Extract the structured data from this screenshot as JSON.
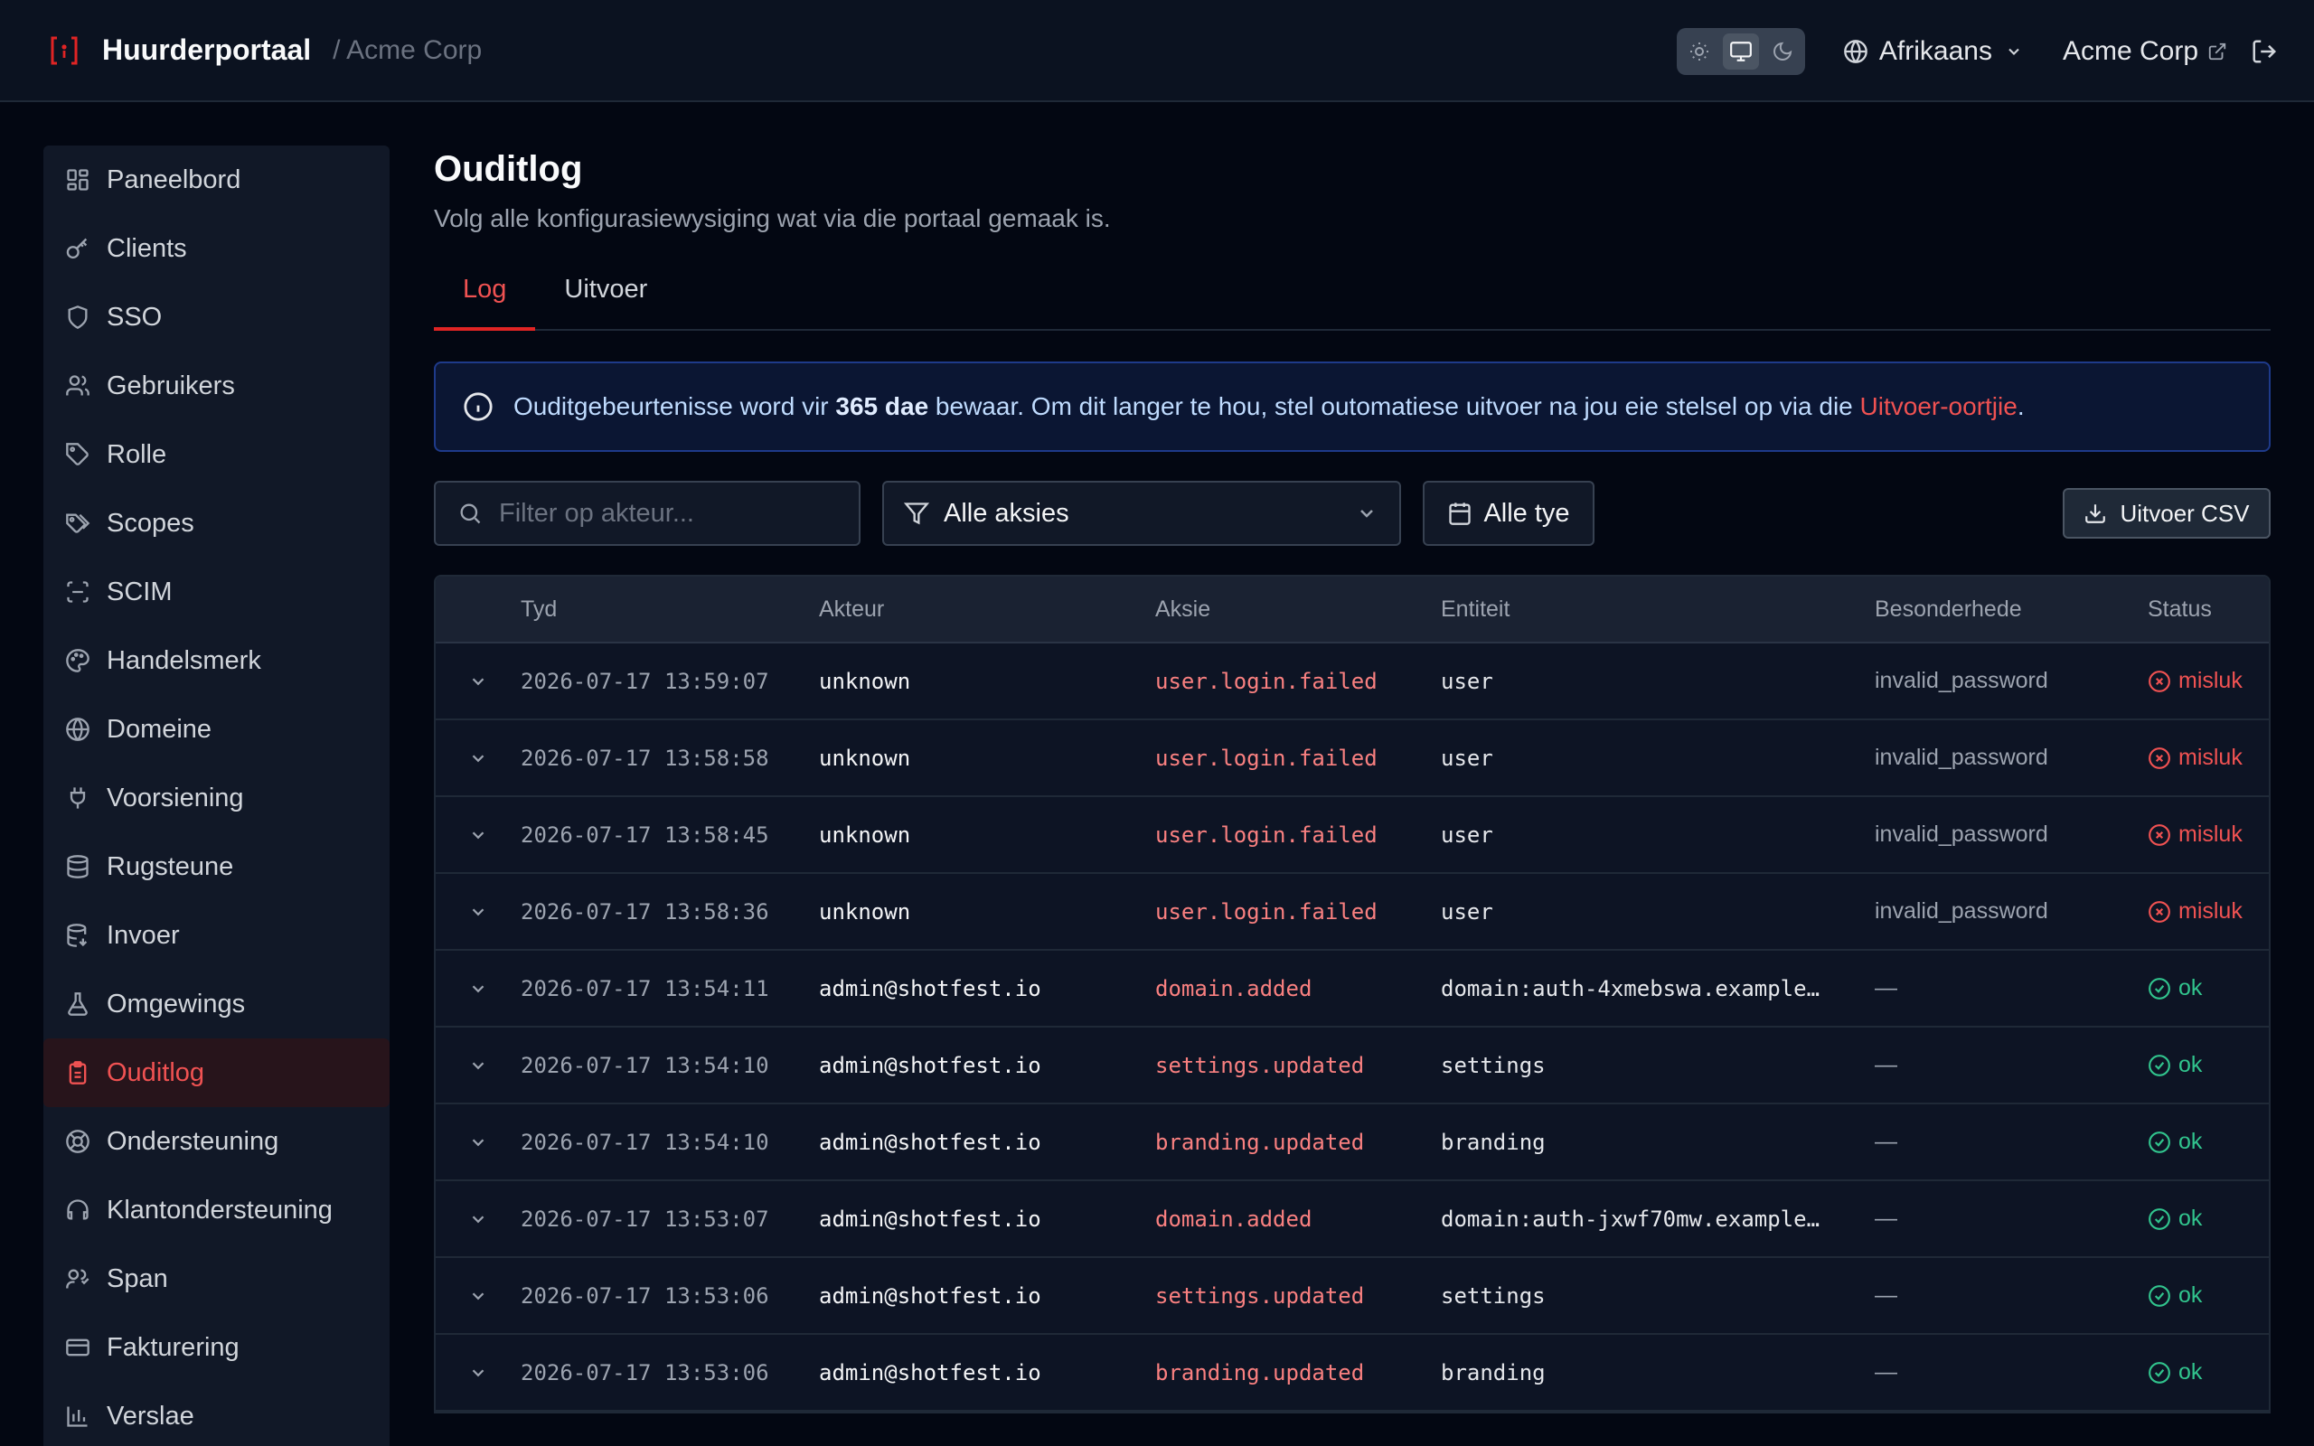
{
  "header": {
    "brand_title": "Huurderportaal",
    "brand_sub": "/ Acme Corp",
    "language": "Afrikaans",
    "org_link": "Acme Corp"
  },
  "sidebar": {
    "items": [
      {
        "label": "Paneelbord",
        "icon": "dashboard-icon"
      },
      {
        "label": "Clients",
        "icon": "key-icon"
      },
      {
        "label": "SSO",
        "icon": "shield-icon"
      },
      {
        "label": "Gebruikers",
        "icon": "users-icon"
      },
      {
        "label": "Rolle",
        "icon": "tag-icon"
      },
      {
        "label": "Scopes",
        "icon": "tags-icon"
      },
      {
        "label": "SCIM",
        "icon": "scan-icon"
      },
      {
        "label": "Handelsmerk",
        "icon": "palette-icon"
      },
      {
        "label": "Domeine",
        "icon": "globe-icon"
      },
      {
        "label": "Voorsiening",
        "icon": "plug-icon"
      },
      {
        "label": "Rugsteune",
        "icon": "database-icon"
      },
      {
        "label": "Invoer",
        "icon": "database-import-icon"
      },
      {
        "label": "Omgewings",
        "icon": "flask-icon"
      },
      {
        "label": "Ouditlog",
        "icon": "clipboard-icon"
      },
      {
        "label": "Ondersteuning",
        "icon": "lifebuoy-icon"
      },
      {
        "label": "Klantondersteuning",
        "icon": "headset-icon"
      },
      {
        "label": "Span",
        "icon": "user-group-icon"
      },
      {
        "label": "Fakturering",
        "icon": "credit-card-icon"
      },
      {
        "label": "Verslae",
        "icon": "bar-chart-icon"
      }
    ],
    "active": "Ouditlog"
  },
  "main": {
    "title": "Ouditlog",
    "subtitle": "Volg alle konfigurasiewysiging wat via die portaal gemaak is.",
    "tabs": [
      {
        "label": "Log"
      },
      {
        "label": "Uitvoer"
      }
    ],
    "banner": {
      "text_before": "Ouditgebeurtenisse word vir ",
      "bold": "365 dae",
      "text_after": " bewaar. Om dit langer te hou, stel outomatiese uitvoer na jou eie stelsel op via die ",
      "link": "Uitvoer-oortjie",
      "end": "."
    },
    "filters": {
      "search_placeholder": "Filter op akteur...",
      "action_select": "Alle aksies",
      "date_range": "Alle tye",
      "export_label": "Uitvoer CSV"
    },
    "table": {
      "headers": {
        "time": "Tyd",
        "actor": "Akteur",
        "action": "Aksie",
        "entity": "Entiteit",
        "details": "Besonderhede",
        "status": "Status"
      },
      "rows": [
        {
          "time": "2026-07-17 13:59:07",
          "actor": "unknown",
          "action": "user.login.failed",
          "entity": "user",
          "details": "invalid_password",
          "status": "misluk"
        },
        {
          "time": "2026-07-17 13:58:58",
          "actor": "unknown",
          "action": "user.login.failed",
          "entity": "user",
          "details": "invalid_password",
          "status": "misluk"
        },
        {
          "time": "2026-07-17 13:58:45",
          "actor": "unknown",
          "action": "user.login.failed",
          "entity": "user",
          "details": "invalid_password",
          "status": "misluk"
        },
        {
          "time": "2026-07-17 13:58:36",
          "actor": "unknown",
          "action": "user.login.failed",
          "entity": "user",
          "details": "invalid_password",
          "status": "misluk"
        },
        {
          "time": "2026-07-17 13:54:11",
          "actor": "admin@shotfest.io",
          "action": "domain.added",
          "entity": "domain:auth-4xmebswa.example…",
          "details": "—",
          "status": "ok"
        },
        {
          "time": "2026-07-17 13:54:10",
          "actor": "admin@shotfest.io",
          "action": "settings.updated",
          "entity": "settings",
          "details": "—",
          "status": "ok"
        },
        {
          "time": "2026-07-17 13:54:10",
          "actor": "admin@shotfest.io",
          "action": "branding.updated",
          "entity": "branding",
          "details": "—",
          "status": "ok"
        },
        {
          "time": "2026-07-17 13:53:07",
          "actor": "admin@shotfest.io",
          "action": "domain.added",
          "entity": "domain:auth-jxwf70mw.example…",
          "details": "—",
          "status": "ok"
        },
        {
          "time": "2026-07-17 13:53:06",
          "actor": "admin@shotfest.io",
          "action": "settings.updated",
          "entity": "settings",
          "details": "—",
          "status": "ok"
        },
        {
          "time": "2026-07-17 13:53:06",
          "actor": "admin@shotfest.io",
          "action": "branding.updated",
          "entity": "branding",
          "details": "—",
          "status": "ok"
        }
      ]
    }
  },
  "colors": {
    "accent": "#e02424",
    "ok": "#31c48d",
    "fail": "#f05252",
    "background": "#030712"
  }
}
